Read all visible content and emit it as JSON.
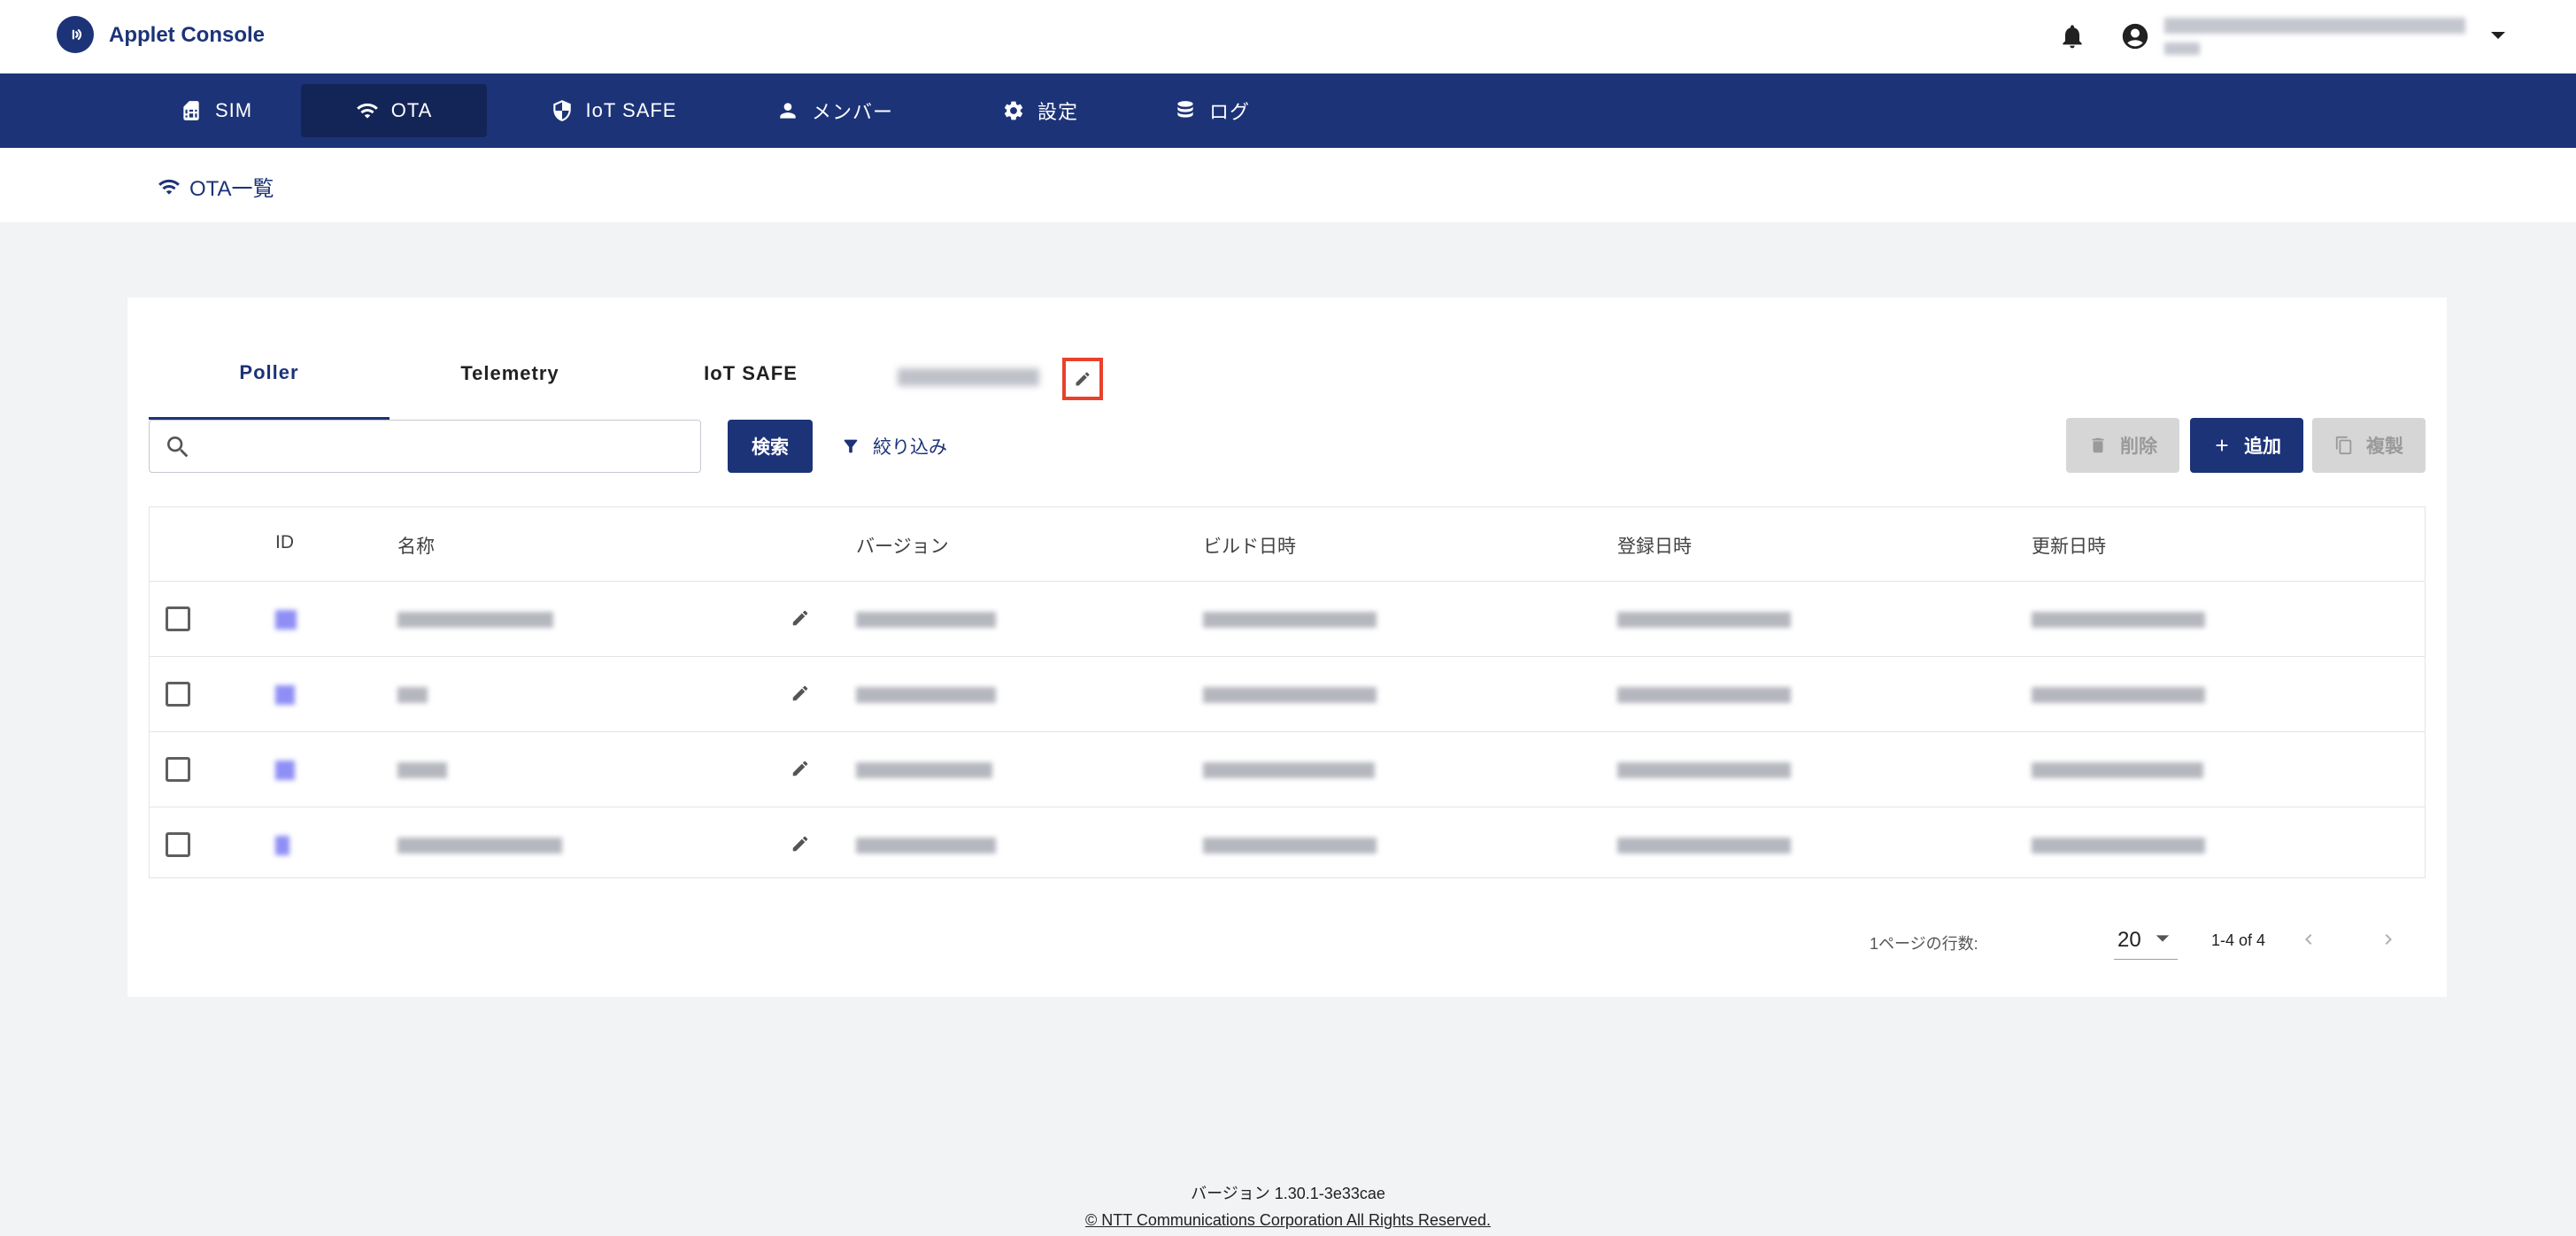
{
  "app": {
    "title": "Applet Console"
  },
  "nav": {
    "items": [
      {
        "label": "SIM",
        "icon": "sim-card-icon"
      },
      {
        "label": "OTA",
        "icon": "wifi-icon",
        "active": true
      },
      {
        "label": "IoT SAFE",
        "icon": "shield-icon"
      },
      {
        "label": "メンバー",
        "icon": "person-icon"
      },
      {
        "label": "設定",
        "icon": "gear-icon"
      },
      {
        "label": "ログ",
        "icon": "database-icon"
      }
    ]
  },
  "breadcrumb": {
    "label": "OTA一覧",
    "icon": "wifi-icon"
  },
  "tabs": [
    {
      "label": "Poller",
      "active": true
    },
    {
      "label": "Telemetry"
    },
    {
      "label": "IoT SAFE"
    }
  ],
  "search": {
    "placeholder": "",
    "value": "",
    "button_label": "検索"
  },
  "filter": {
    "label": "絞り込み"
  },
  "actions": {
    "delete_label": "削除",
    "add_label": "追加",
    "copy_label": "複製"
  },
  "table": {
    "columns": [
      "ID",
      "名称",
      "バージョン",
      "ビルド日時",
      "登録日時",
      "更新日時"
    ]
  },
  "pagination": {
    "rows_per_page_label": "1ページの行数:",
    "rows_per_page": "20",
    "range": "1-4 of 4"
  },
  "footer": {
    "version": "バージョン 1.30.1-3e33cae",
    "copyright": "© NTT Communications Corporation All Rights Reserved."
  },
  "colors": {
    "primary": "#1c3378",
    "highlight": "#e8412b",
    "background": "#f2f3f5"
  }
}
